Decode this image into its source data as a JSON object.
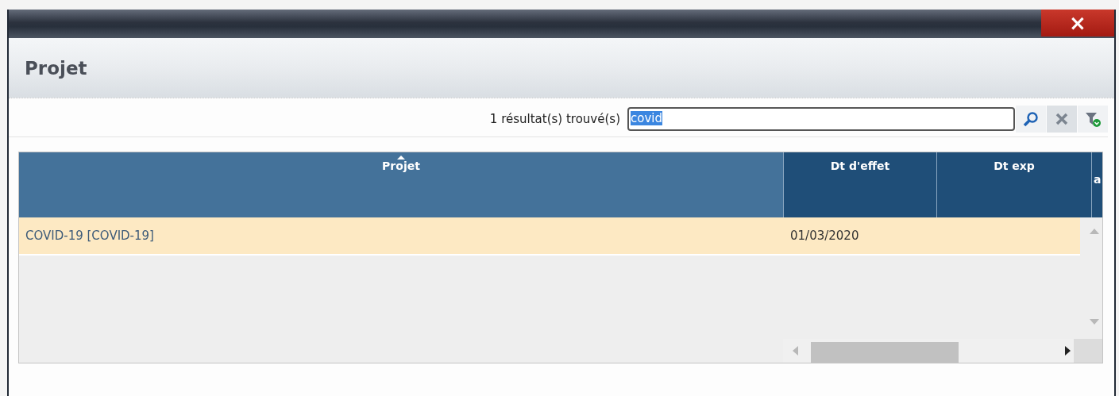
{
  "window": {
    "close_label": "×"
  },
  "header": {
    "title": "Projet"
  },
  "search": {
    "result_count": "1 résultat(s) trouvé(s)",
    "value": "covid",
    "value_selected": true
  },
  "table": {
    "columns": [
      {
        "label": "Projet",
        "sorted": true,
        "kind": "main"
      },
      {
        "label": "Dt d'effet",
        "sorted": false,
        "kind": "normal"
      },
      {
        "label": "Dt exp",
        "sorted": false,
        "kind": "normal"
      },
      {
        "label": "a",
        "sorted": false,
        "kind": "cut"
      }
    ],
    "rows": [
      {
        "selected": true,
        "cells": [
          "COVID-19 [COVID-19]",
          "01/03/2020",
          ""
        ]
      }
    ]
  }
}
